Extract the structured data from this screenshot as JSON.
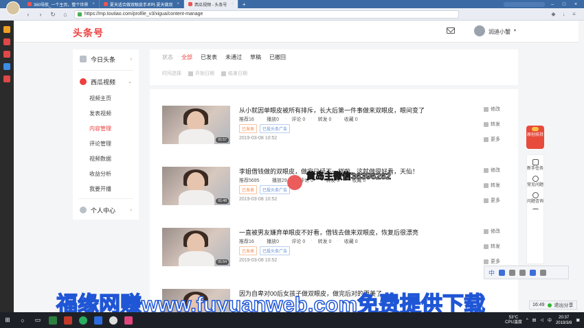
{
  "browser": {
    "tabs": [
      {
        "label": "360导航_一个主页，整个世界",
        "active": false
      },
      {
        "label": "夏天适合做双眼皮手术吗 夏天做双",
        "active": false
      },
      {
        "label": "西瓜视频 - 头条号",
        "active": true
      }
    ],
    "new_tab": "+",
    "url": "https://mp.toutiao.com/profile_v3/xigua/content-manage",
    "nav": {
      "back": "‹",
      "forward": "›",
      "refresh": "↻",
      "home": "⌂"
    }
  },
  "header": {
    "logo": "头条号",
    "username": "润迪小蟹",
    "caret": "▾"
  },
  "sidebar": {
    "sections": [
      {
        "label": "今日头条",
        "icon": "toutiao-icon",
        "chev": "›"
      },
      {
        "label": "西瓜视频",
        "icon": "xigua-icon",
        "chev": "⌄"
      },
      {
        "label": "个人中心",
        "icon": "user-icon",
        "chev": "›"
      }
    ],
    "items": [
      {
        "label": "视频主页",
        "active": false
      },
      {
        "label": "发表视频",
        "active": false
      },
      {
        "label": "内容管理",
        "active": true
      },
      {
        "label": "评论管理",
        "active": false
      },
      {
        "label": "视频数据",
        "active": false
      },
      {
        "label": "收益分析",
        "active": false
      },
      {
        "label": "我要开播",
        "active": false
      }
    ]
  },
  "filters": {
    "status_label": "状态",
    "options": [
      "全部",
      "已发表",
      "未通过",
      "草稿",
      "已撤回"
    ],
    "selected": "全部",
    "time_label": "时间选择",
    "sub1": "开始日期",
    "sub2": "结束日期"
  },
  "videos": [
    {
      "title": "从小就因单眼皮被所有排斥，长大后第一件事做来双眼皮，眼间变了",
      "duration": "01:57",
      "stats": [
        "推荐16",
        "播放0",
        "评论 0",
        "转发 0",
        "收藏 0"
      ],
      "badges": [
        "已发表",
        "已投头条广告"
      ],
      "date": "2019-03-08 10:52"
    },
    {
      "title": "李姐借钱做的双眼皮，做完已经不一样啦，这就做很好看，天仙！",
      "duration": "01:48",
      "stats": [
        "推荐5695",
        "播放29",
        "评论 0",
        "转发 0",
        "收藏 0"
      ],
      "badges": [
        "已发表",
        "已投头条广告"
      ],
      "date": "2019-03-08 10:52"
    },
    {
      "title": "一直被男友嫌弃单眼皮不好看，借钱去做来双眼皮，恢复后很漂亮",
      "duration": "01:54",
      "stats": [
        "推荐16",
        "播放0",
        "评论 0",
        "转发 0",
        "收藏 0"
      ],
      "badges": [
        "已发表",
        "已投头条广告"
      ],
      "date": "2019-03-08 10:52"
    },
    {
      "title": "因为自卑对00后女孩子做双眼皮，做完后对的更美了",
      "duration": "",
      "stats": [],
      "badges": [],
      "date": ""
    }
  ],
  "actions": {
    "edit": "修改",
    "share": "转发",
    "more": "更多"
  },
  "right_panel": {
    "promo": "原创扶持",
    "items": [
      {
        "label": "新手任务",
        "icon": "clipboard-icon"
      },
      {
        "label": "常见问题",
        "icon": "question-icon"
      },
      {
        "label": "问题咨询",
        "icon": "headset-icon"
      },
      {
        "label": "",
        "icon": "back-to-top-icon"
      }
    ]
  },
  "overlays": {
    "wechat_watermark": "黄岛主微信36396262",
    "bottom_banner": "福缘网赚www.fuyuanweb.com免费提供下载"
  },
  "ime": {
    "lang": "中"
  },
  "share_widget": {
    "time": "16:49",
    "label": "退出分享"
  },
  "taskbar": {
    "weather_temp": "53°C",
    "weather_label": "CPU温度",
    "ime": "中",
    "time": "20:37",
    "date": "2019/3/8"
  }
}
